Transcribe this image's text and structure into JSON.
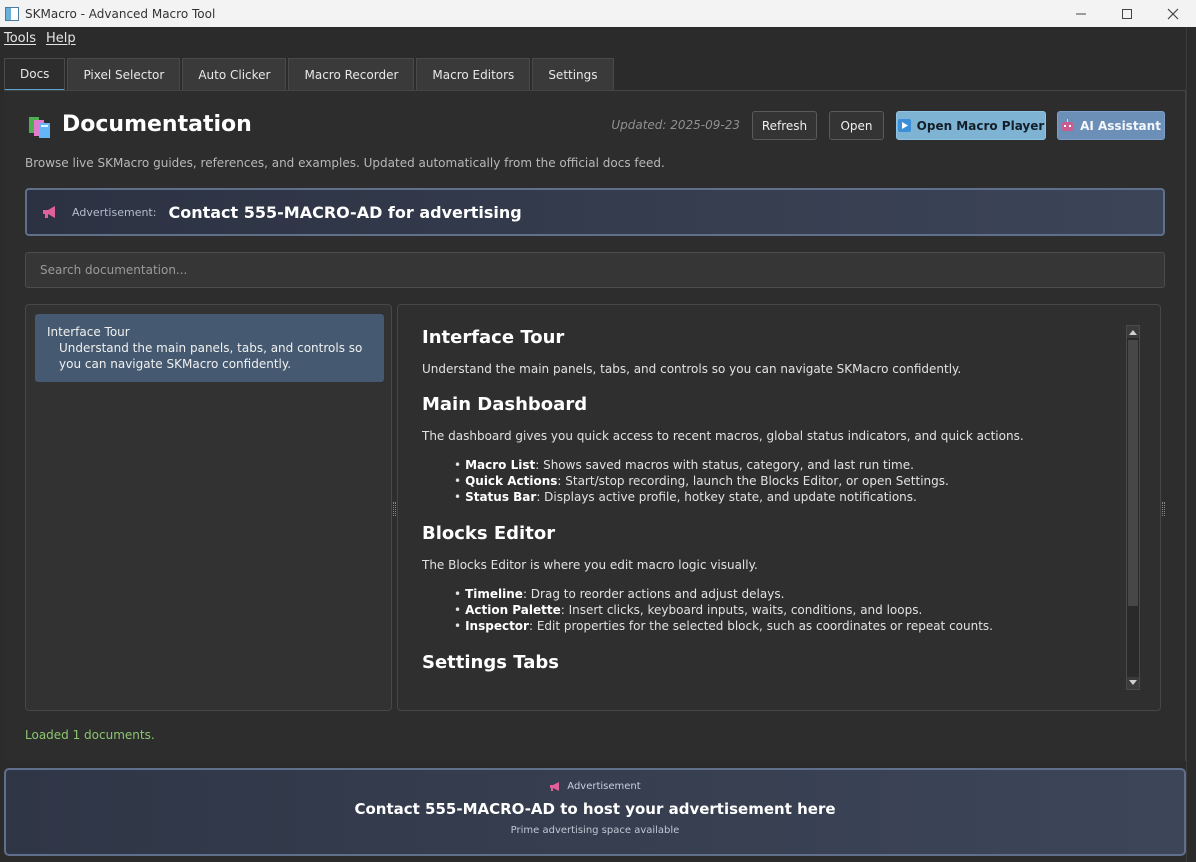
{
  "window": {
    "title": "SKMacro - Advanced Macro Tool"
  },
  "menu": {
    "items": [
      {
        "label": "Tools"
      },
      {
        "label": "Help"
      }
    ]
  },
  "tabs": [
    {
      "label": "Docs"
    },
    {
      "label": "Pixel Selector"
    },
    {
      "label": "Auto Clicker"
    },
    {
      "label": "Macro Recorder"
    },
    {
      "label": "Macro Editors"
    },
    {
      "label": "Settings"
    }
  ],
  "docs": {
    "title": "Documentation",
    "updated": "Updated: 2025-09-23",
    "refresh_label": "Refresh",
    "open_label": "Open",
    "player_label": "Open Macro Player",
    "ai_label": "AI Assistant",
    "subtitle": "Browse live SKMacro guides, references, and examples. Updated automatically from the official docs feed.",
    "ad": {
      "label": "Advertisement:",
      "text": "Contact 555-MACRO-AD for advertising"
    },
    "search_placeholder": "Search documentation...",
    "list": [
      {
        "title": "Interface Tour",
        "desc": "Understand the main panels, tabs, and controls so you can navigate SKMacro confidently."
      }
    ],
    "content": {
      "h1": "Interface Tour",
      "intro": "Understand the main panels, tabs, and controls so you can navigate SKMacro confidently.",
      "s1_title": "Main Dashboard",
      "s1_text": "The dashboard gives you quick access to recent macros, global status indicators, and quick actions.",
      "s1_items": [
        {
          "term": "Macro List",
          "text": ": Shows saved macros with status, category, and last run time."
        },
        {
          "term": "Quick Actions",
          "text": ": Start/stop recording, launch the Blocks Editor, or open Settings."
        },
        {
          "term": "Status Bar",
          "text": ": Displays active profile, hotkey state, and update notifications."
        }
      ],
      "s2_title": "Blocks Editor",
      "s2_text": "The Blocks Editor is where you edit macro logic visually.",
      "s2_items": [
        {
          "term": "Timeline",
          "text": ": Drag to reorder actions and adjust delays."
        },
        {
          "term": "Action Palette",
          "text": ": Insert clicks, keyboard inputs, waits, conditions, and loops."
        },
        {
          "term": "Inspector",
          "text": ": Edit properties for the selected block, such as coordinates or repeat counts."
        }
      ],
      "s3_title": "Settings Tabs"
    },
    "status": "Loaded 1 documents."
  },
  "bottom_ad": {
    "label": "Advertisement",
    "text": "Contact 555-MACRO-AD to host your advertisement here",
    "sub": "Prime advertising space available"
  },
  "colors": {
    "accent": "#7fb3d3",
    "ai": "#6c8fb8",
    "status": "#8cc66f",
    "selection": "#455a70"
  }
}
